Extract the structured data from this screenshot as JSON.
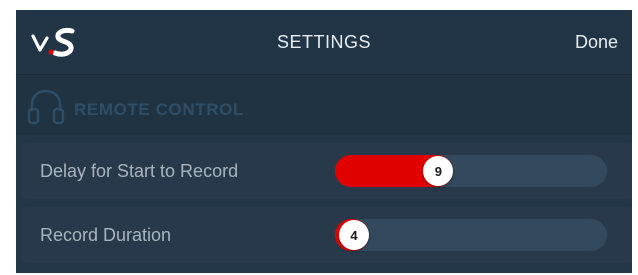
{
  "header": {
    "title": "SETTINGS",
    "done_label": "Done",
    "logo_icon": "lvs-logo"
  },
  "section": {
    "label": "REMOTE CONTROL",
    "icon": "headphones-icon"
  },
  "settings": [
    {
      "label": "Delay for Start to Record",
      "value": "9",
      "level": 0.38
    },
    {
      "label": "Record Duration",
      "value": "4",
      "level": 0.07
    }
  ],
  "colors": {
    "background": "#233748",
    "accent": "#e00000",
    "track": "#334a5e",
    "section_text": "#2f4e66"
  }
}
